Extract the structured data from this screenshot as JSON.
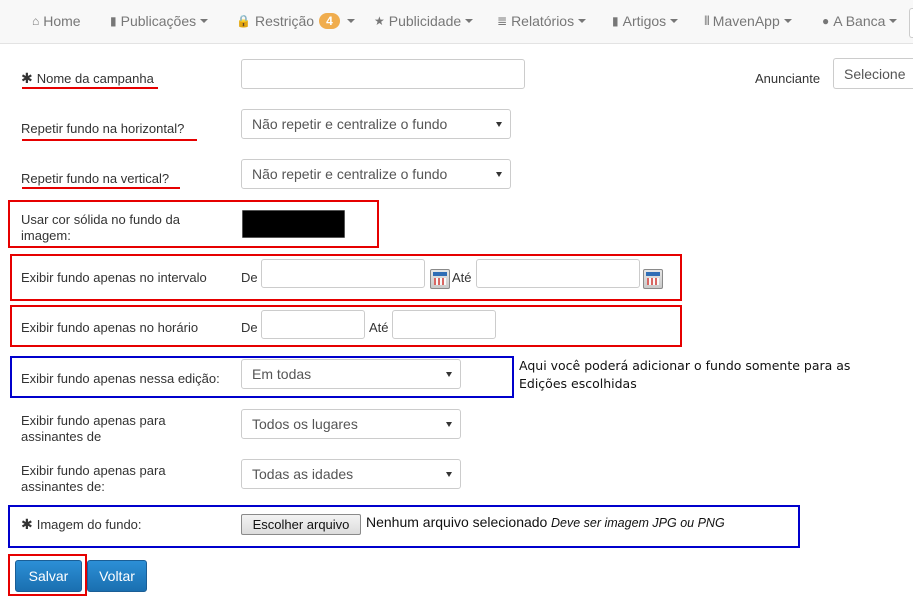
{
  "nav": {
    "items": [
      {
        "icon": "⌂",
        "label": "Home",
        "caret": false
      },
      {
        "icon": "▮",
        "label": "Publicações",
        "caret": true
      },
      {
        "icon": "🔒",
        "label": "Restrição",
        "caret": true,
        "badge": "4"
      },
      {
        "icon": "★",
        "label": "Publicidade",
        "caret": true
      },
      {
        "icon": "≣",
        "label": "Relatórios",
        "caret": true
      },
      {
        "icon": "▮",
        "label": "Artigos",
        "caret": true
      },
      {
        "icon": "|||",
        "label": "MavenApp",
        "caret": true
      },
      {
        "icon": "●",
        "label": "A Banca",
        "caret": true
      }
    ]
  },
  "form": {
    "required_mark": "✱",
    "campaign_name": {
      "label": "Nome da campanha",
      "value": ""
    },
    "advertiser": {
      "label": "Anunciante",
      "selected": "Selecione"
    },
    "repeat_horizontal": {
      "label": "Repetir fundo na horizontal?",
      "selected": "Não repetir e centralize o fundo"
    },
    "repeat_vertical": {
      "label": "Repetir fundo na vertical?",
      "selected": "Não repetir e centralize o fundo"
    },
    "solid_color": {
      "label": "Usar cor sólida no fundo da imagem:",
      "color": "#000000"
    },
    "date_interval": {
      "label": "Exibir fundo apenas no intervalo",
      "from_label": "De",
      "to_label": "Até",
      "from_value": "",
      "to_value": ""
    },
    "time_interval": {
      "label": "Exibir fundo apenas no horário",
      "from_label": "De",
      "to_label": "Até",
      "from_value": "",
      "to_value": ""
    },
    "edition": {
      "label": "Exibir fundo apenas nessa edição:",
      "selected": "Em todas"
    },
    "subscribers_location": {
      "label": "Exibir fundo apenas para assinantes de",
      "selected": "Todos os lugares"
    },
    "subscribers_age": {
      "label": "Exibir fundo apenas para assinantes de:",
      "selected": "Todas as idades"
    },
    "background_image": {
      "label": "Imagem do fundo:",
      "button": "Escolher arquivo",
      "status": "Nenhum arquivo selecionado",
      "hint": "Deve ser imagem JPG ou PNG"
    }
  },
  "annotation": {
    "edition_note": "Aqui você poderá adicionar o fundo somente para as Edições escolhidas"
  },
  "buttons": {
    "save": "Salvar",
    "back": "Voltar"
  },
  "colors": {
    "badge": "#f0ad4e",
    "primary": "#1f7bc1",
    "annotation_red": "#e60000",
    "annotation_blue": "#0000cc"
  }
}
